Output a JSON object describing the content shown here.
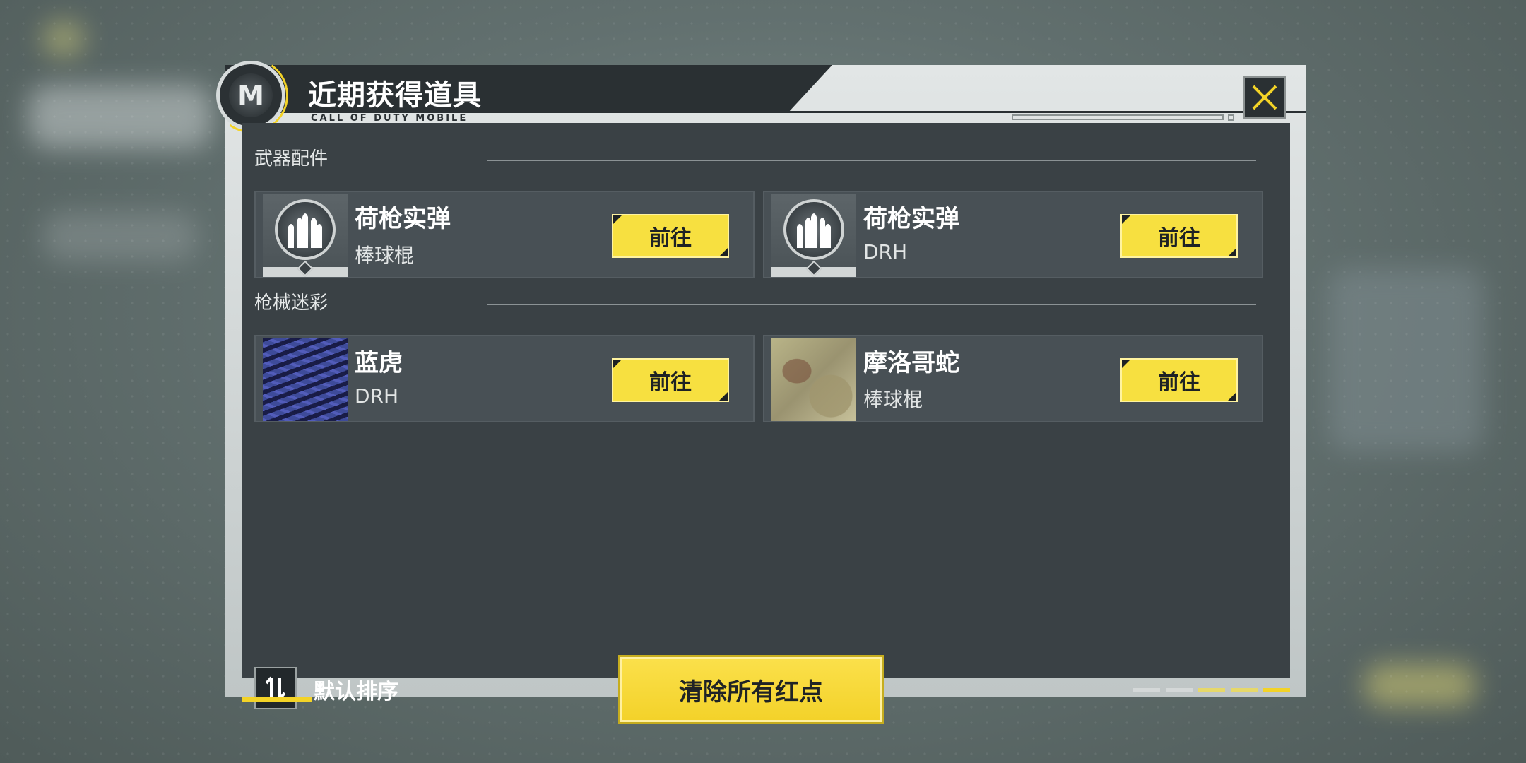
{
  "dialog": {
    "title": "近期获得道具",
    "subtitle": "CALL OF DUTY MOBILE",
    "logo_letter": "M",
    "close_icon": "close-x-icon"
  },
  "sections": [
    {
      "label": "武器配件",
      "items": [
        {
          "name": "荷枪实弹",
          "sub": "棒球棍",
          "button": "前往",
          "icon": "bullets-medal-icon"
        },
        {
          "name": "荷枪实弹",
          "sub": "DRH",
          "button": "前往",
          "icon": "bullets-medal-icon"
        }
      ]
    },
    {
      "label": "枪械迷彩",
      "items": [
        {
          "name": "蓝虎",
          "sub": "DRH",
          "button": "前往",
          "icon": "blue-tiger-camo-thumbnail"
        },
        {
          "name": "摩洛哥蛇",
          "sub": "棒球棍",
          "button": "前往",
          "icon": "moroccan-snake-camo-thumbnail"
        }
      ]
    }
  ],
  "footer": {
    "sort_label": "默认排序",
    "sort_icon": "sort-arrows-icon",
    "clear_button": "清除所有红点"
  },
  "colors": {
    "accent_yellow": "#f7e040",
    "panel_dark": "#3a4145",
    "card": "#485055"
  }
}
